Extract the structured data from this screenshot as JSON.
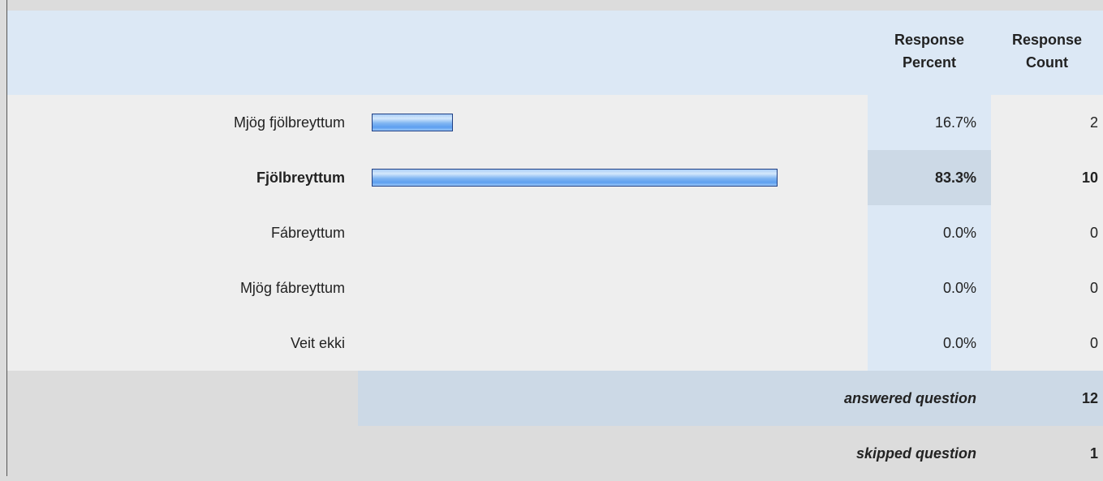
{
  "header": {
    "percent_label_line1": "Response",
    "percent_label_line2": "Percent",
    "count_label_line1": "Response",
    "count_label_line2": "Count"
  },
  "chart_data": {
    "type": "bar",
    "orientation": "horizontal",
    "categories": [
      "Mjög fjölbreyttum",
      "Fjölbreyttum",
      "Fábreyttum",
      "Mjög fábreyttum",
      "Veit ekki"
    ],
    "percent_values": [
      16.7,
      83.3,
      0.0,
      0.0,
      0.0
    ],
    "percent_labels": [
      "16.7%",
      "83.3%",
      "0.0%",
      "0.0%",
      "0.0%"
    ],
    "counts": [
      2,
      10,
      0,
      0,
      0
    ],
    "highlight_index": 1,
    "xlim": [
      0,
      100
    ]
  },
  "summary": {
    "answered_label": "answered question",
    "answered_value": "12",
    "skipped_label": "skipped question",
    "skipped_value": "1"
  },
  "colors": {
    "header_bg": "#dce8f5",
    "row_bg": "#eeeeee",
    "highlight_bg": "#ccd9e6",
    "bar_border": "#1f3f84",
    "bar_fill": "#7fb5f2"
  }
}
